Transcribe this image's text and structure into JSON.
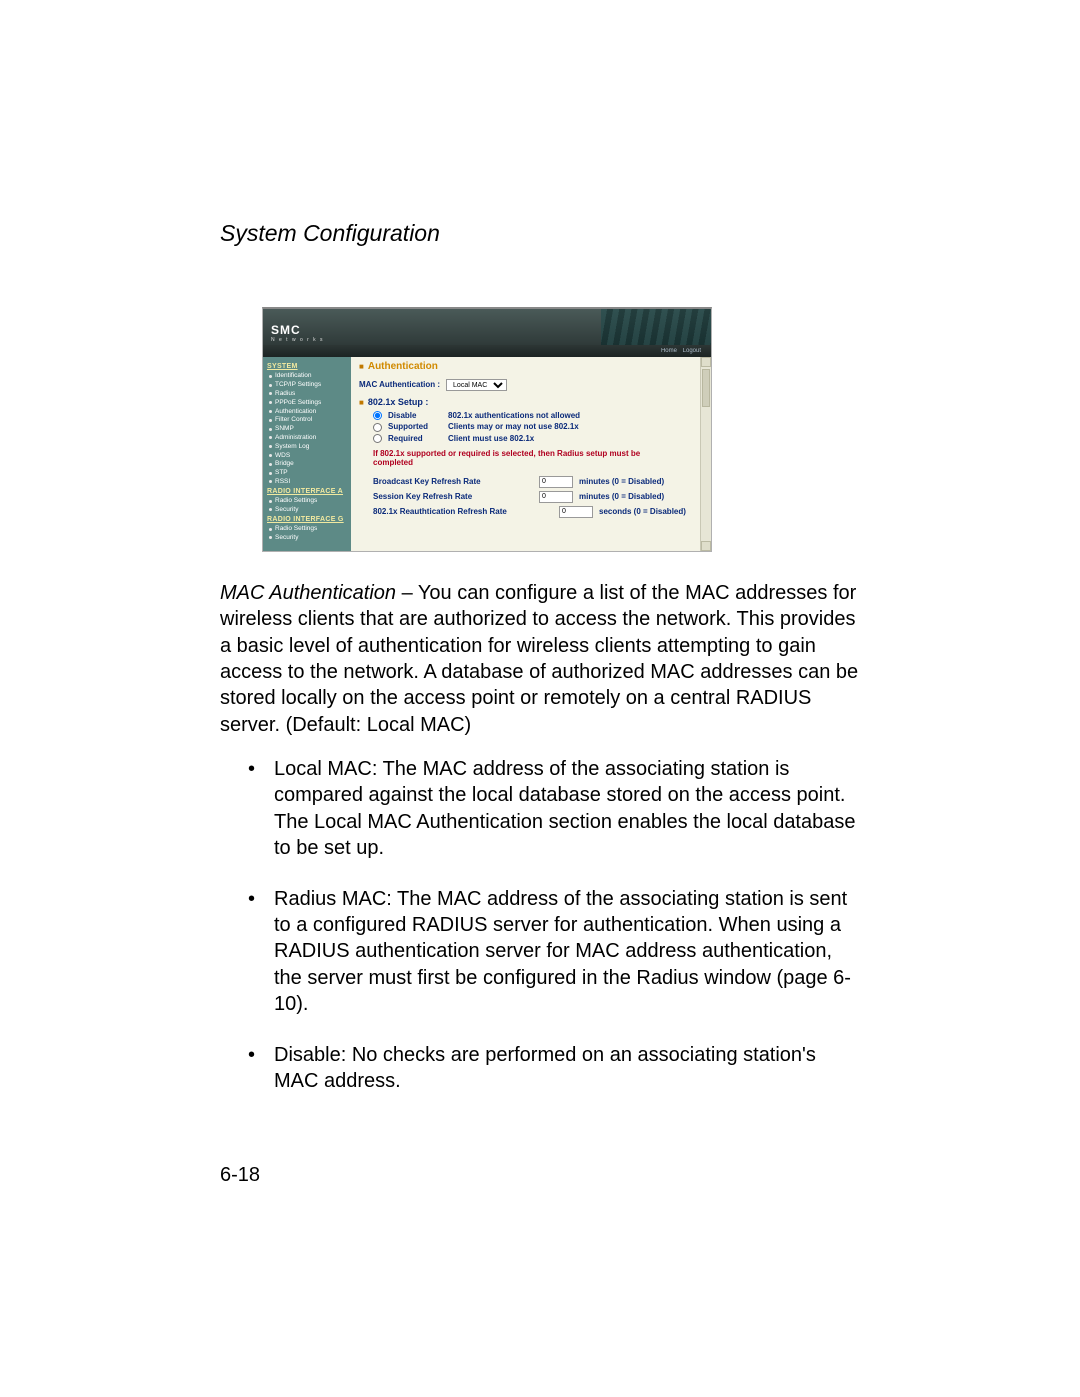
{
  "doc": {
    "section_title": "System Configuration",
    "page_number": "6-18",
    "para_lead": "MAC Authentication",
    "para_rest": " – You can configure a list of the MAC addresses for wireless clients that are authorized to access the network. This provides a basic level of authentication for wireless clients attempting to gain access to the network. A database of authorized MAC addresses can be stored locally on the access point or remotely on a central RADIUS server. (Default: Local MAC)",
    "bullets": [
      "Local MAC: The MAC address of the associating station is compared against the local database stored on the access point. The Local MAC Authentication section enables the local database to be set up.",
      "Radius MAC: The MAC address of the associating station is sent to a configured RADIUS server for authentication. When using a RADIUS authentication server for MAC address authentication, the server must first be configured in the Radius window (page 6-10).",
      "Disable: No checks are performed on an associating station's MAC address."
    ]
  },
  "screenshot": {
    "brand": "SMC",
    "brand_sub": "N e t w o r k s",
    "subbar_home": "Home",
    "subbar_logout": "Logout",
    "sidebar": {
      "group1": "SYSTEM",
      "items1": [
        "Identification",
        "TCP/IP Settings",
        "Radius",
        "PPPoE Settings",
        "Authentication",
        "Filter Control",
        "SNMP",
        "Administration",
        "System Log",
        "WDS",
        "Bridge",
        "STP",
        "RSSI"
      ],
      "group2": "RADIO INTERFACE A",
      "items2": [
        "Radio Settings",
        "Security"
      ],
      "group3": "RADIO INTERFACE G",
      "items3": [
        "Radio Settings",
        "Security"
      ]
    },
    "panel": {
      "title": "Authentication",
      "mac_label": "MAC Authentication :",
      "mac_selected": "Local MAC",
      "setup_title": "802.1x Setup :",
      "options": [
        {
          "label": "Disable",
          "desc": "802.1x authentications not allowed",
          "checked": true
        },
        {
          "label": "Supported",
          "desc": "Clients may or may not use 802.1x",
          "checked": false
        },
        {
          "label": "Required",
          "desc": "Client must use 802.1x",
          "checked": false
        }
      ],
      "note": "If 802.1x supported or required is selected, then Radius setup must be completed",
      "rows": [
        {
          "label": "Broadcast Key Refresh Rate",
          "value": "0",
          "unit": "minutes  (0 = Disabled)"
        },
        {
          "label": "Session Key Refresh Rate",
          "value": "0",
          "unit": "minutes  (0 = Disabled)"
        },
        {
          "label": "802.1x Reauthtication Refresh Rate",
          "value": "0",
          "unit": "seconds  (0 = Disabled)"
        }
      ]
    }
  }
}
